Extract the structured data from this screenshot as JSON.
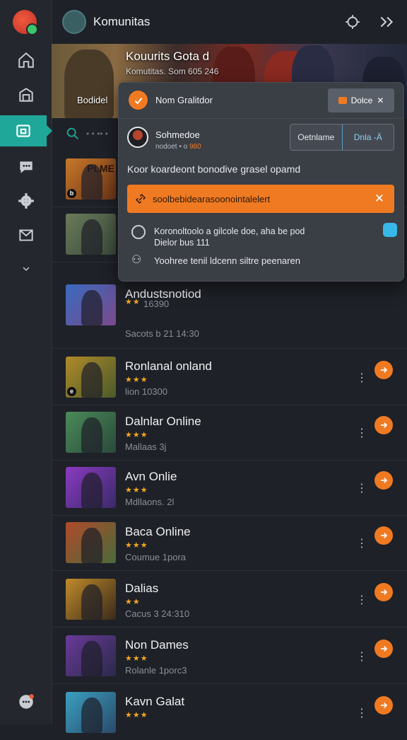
{
  "header": {
    "title": "Komunitas"
  },
  "banner": {
    "title": "Kouurits Gota d",
    "subtitle": "Komutitas. Som 605 246",
    "tag": "Bodidel"
  },
  "search": {
    "placeholder": "• • •• •"
  },
  "popup": {
    "title": "Nom Gralitdor",
    "close_label": "Dolce",
    "user_name": "Sohmedoe",
    "user_meta": "nodoet • o",
    "user_meta_accent": "980",
    "segment_left": "Oetnlame",
    "segment_right": "Dnla -Ä",
    "description": "Koor koardeont bonodive grasel opamd",
    "alert_text": "soolbebidearasoonointalelert",
    "info_line1": "Koronoltoolo a gilcole  doe,  aha be pod",
    "info_line2": "Dielor bus  111",
    "note": "Yoohree tenil ldcenn siltre peenaren"
  },
  "games": [
    {
      "title": "",
      "stars": "",
      "meta": "",
      "thumb_label": "PLME",
      "badge": "b"
    },
    {
      "title": "",
      "stars": "",
      "meta": "",
      "thumb_label": "",
      "badge": ""
    },
    {
      "title": "Andustsnotiod",
      "stars": "★★",
      "meta": "16390",
      "meta2": "Sacots b 21 14:30",
      "thumb_label": "",
      "badge": ""
    },
    {
      "title": "Ronlanal onland",
      "stars": "★★★",
      "meta": "lion 10300",
      "thumb_label": "",
      "badge": "e"
    },
    {
      "title": "Dalnlar Online",
      "stars": "★★★",
      "meta": "Mallaas 3j",
      "thumb_label": "",
      "badge": ""
    },
    {
      "title": "Avn Onlie",
      "stars": "★★★",
      "meta": "Mdllaons. 2l",
      "thumb_label": "",
      "badge": ""
    },
    {
      "title": "Baca Online",
      "stars": "★★★",
      "meta": "Coumue 1pora",
      "thumb_label": "",
      "badge": ""
    },
    {
      "title": "Dalias",
      "stars": "★★",
      "meta": "Cacus 3 24:310",
      "thumb_label": "",
      "badge": ""
    },
    {
      "title": "Non Dames",
      "stars": "★★★",
      "meta": "Rolanle 1porc3",
      "thumb_label": "",
      "badge": ""
    },
    {
      "title": "Kavn Galat",
      "stars": "★★★",
      "meta": "",
      "thumb_label": "",
      "badge": ""
    }
  ],
  "colors": {
    "accent_orange": "#f07a22",
    "active_teal": "#1fa89a",
    "background": "#1e2127"
  }
}
